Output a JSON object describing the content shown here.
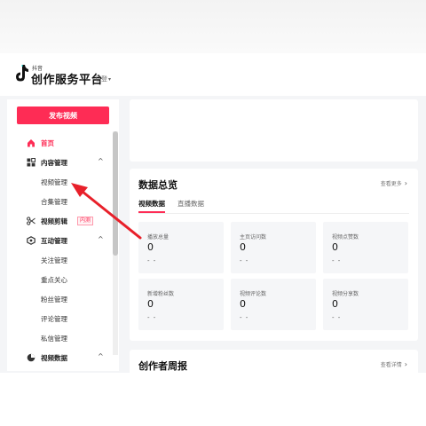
{
  "header": {
    "brand_small": "抖音",
    "brand_main": "创作服务平台",
    "login_label": "已登",
    "caret": "▾"
  },
  "sidebar": {
    "publish_label": "发布视频",
    "home": "首页",
    "content_mgmt": "内容管理",
    "video_mgmt": "视频管理",
    "collection_mgmt": "合集管理",
    "video_edit": "视频剪辑",
    "video_edit_badge": "内测",
    "interaction_mgmt": "互动管理",
    "follow_mgmt": "关注管理",
    "key_care": "重点关心",
    "fans_mgmt": "粉丝管理",
    "comment_mgmt": "评论管理",
    "message_mgmt": "私信管理",
    "video_data": "视频数据",
    "chevron_up": "^"
  },
  "data_overview": {
    "title": "数据总览",
    "see_more": "查看更多",
    "arrow": "›",
    "tab_active": "视频数据",
    "tab_inactive": "直播数据",
    "stats": [
      {
        "label": "播放总量",
        "value": "0",
        "delta": "- -"
      },
      {
        "label": "主页访问数",
        "value": "0",
        "delta": "- -"
      },
      {
        "label": "视频点赞数",
        "value": "0",
        "delta": "- -"
      },
      {
        "label": "新增粉丝数",
        "value": "0",
        "delta": "- -"
      },
      {
        "label": "视频评论数",
        "value": "0",
        "delta": "- -"
      },
      {
        "label": "视频分享数",
        "value": "0",
        "delta": "- -"
      }
    ]
  },
  "weekly": {
    "title": "创作者周报",
    "see_detail": "查看详情",
    "arrow": "›"
  },
  "colors": {
    "accent": "#fe2c55",
    "annotation_arrow": "#e8202a"
  },
  "icons": [
    "douyin-logo-icon",
    "home-icon",
    "grid-icon",
    "scissors-icon",
    "interaction-icon",
    "pie-chart-icon"
  ]
}
